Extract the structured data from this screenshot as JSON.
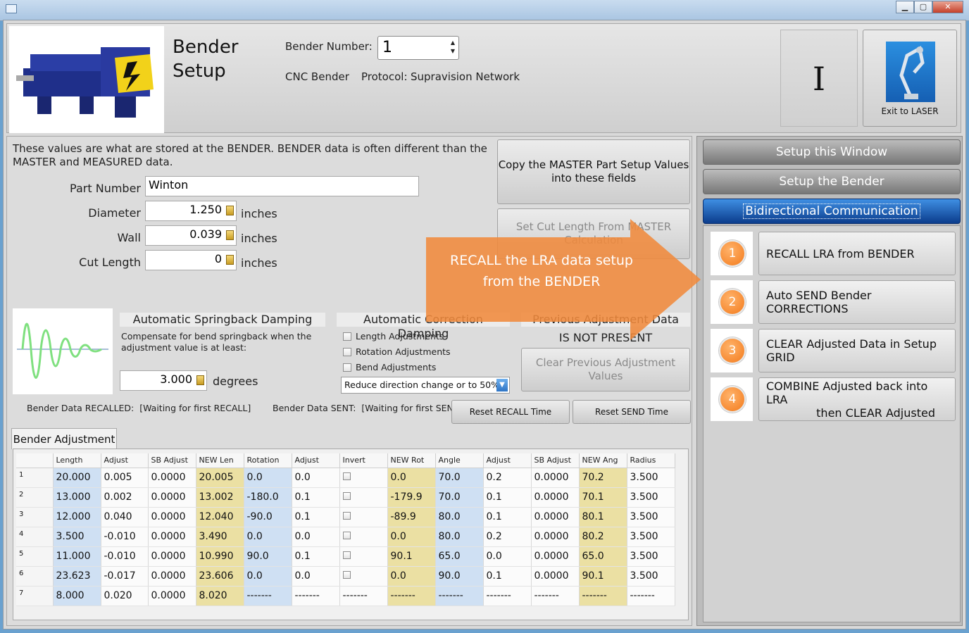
{
  "window": {
    "min": "▁",
    "max": "▢",
    "close": "✕"
  },
  "header": {
    "title_line1": "Bender",
    "title_line2": "Setup",
    "bender_number_label": "Bender Number:",
    "bender_number_value": "1",
    "bender_type": "CNC Bender",
    "protocol_label": "Protocol:",
    "protocol_value": "Supravision Network",
    "indicator": "I",
    "exit_label": "Exit to LASER"
  },
  "description": "These values are what are stored at the BENDER.  BENDER data is often different than the MASTER and MEASURED data.",
  "fields": {
    "part_number_label": "Part Number",
    "part_number_value": "Winton",
    "diameter_label": "Diameter",
    "diameter_value": "1.250",
    "wall_label": "Wall",
    "wall_value": "0.039",
    "cut_length_label": "Cut Length",
    "cut_length_value": "0",
    "unit": "inches"
  },
  "buttons": {
    "copy_master": "Copy the MASTER Part Setup Values into these fields",
    "set_cut_length": "Set Cut Length From MASTER Calculation",
    "clear_previous": "Clear Previous Adjustment Values",
    "reset_recall": "Reset RECALL Time",
    "reset_send": "Reset SEND Time"
  },
  "springback": {
    "header": "Automatic Springback Damping",
    "desc": "Compensate for bend springback when the adjustment value is at least:",
    "value": "3.000",
    "unit": "degrees"
  },
  "correction": {
    "header": "Automatic Correction Damping",
    "options": [
      "Length Adjustments",
      "Rotation Adjustments",
      "Bend Adjustments"
    ],
    "dropdown": "Reduce direction change or to 50%"
  },
  "previous": {
    "header": "Previous Adjustment Data",
    "status": "IS NOT PRESENT"
  },
  "status": {
    "recalled_label": "Bender Data RECALLED:",
    "recalled_value": "[Waiting for first RECALL]",
    "sent_label": "Bender Data SENT:",
    "sent_value": "[Waiting for first SEND]"
  },
  "tab_label": "Bender Adjustment",
  "grid": {
    "columns": [
      "Length",
      "Adjust",
      "SB Adjust",
      "NEW Len",
      "Rotation",
      "Adjust",
      "Invert",
      "NEW Rot",
      "Angle",
      "Adjust",
      "SB Adjust",
      "NEW Ang",
      "Radius"
    ],
    "rows": [
      [
        "1",
        "20.000",
        "0.005",
        "0.0000",
        "20.005",
        "0.0",
        "0.0",
        "chk",
        "0.0",
        "70.0",
        "0.2",
        "0.0000",
        "70.2",
        "3.500"
      ],
      [
        "2",
        "13.000",
        "0.002",
        "0.0000",
        "13.002",
        "-180.0",
        "0.1",
        "chk",
        "-179.9",
        "70.0",
        "0.1",
        "0.0000",
        "70.1",
        "3.500"
      ],
      [
        "3",
        "12.000",
        "0.040",
        "0.0000",
        "12.040",
        "-90.0",
        "0.1",
        "chk",
        "-89.9",
        "80.0",
        "0.1",
        "0.0000",
        "80.1",
        "3.500"
      ],
      [
        "4",
        "3.500",
        "-0.010",
        "0.0000",
        "3.490",
        "0.0",
        "0.0",
        "chk",
        "0.0",
        "80.0",
        "0.2",
        "0.0000",
        "80.2",
        "3.500"
      ],
      [
        "5",
        "11.000",
        "-0.010",
        "0.0000",
        "10.990",
        "90.0",
        "0.1",
        "chk",
        "90.1",
        "65.0",
        "0.0",
        "0.0000",
        "65.0",
        "3.500"
      ],
      [
        "6",
        "23.623",
        "-0.017",
        "0.0000",
        "23.606",
        "0.0",
        "0.0",
        "chk",
        "0.0",
        "90.0",
        "0.1",
        "0.0000",
        "90.1",
        "3.500"
      ],
      [
        "7",
        "8.000",
        "0.020",
        "0.0000",
        "8.020",
        "-------",
        "-------",
        "-------",
        "-------",
        "-------",
        "-------",
        "-------",
        "-------",
        "-------"
      ]
    ]
  },
  "nav": {
    "setup_window": "Setup this Window",
    "setup_bender": "Setup the Bender",
    "bidirectional": "Bidirectional Communication"
  },
  "steps": [
    {
      "num": "1",
      "line1": "RECALL LRA from BENDER",
      "line2": ""
    },
    {
      "num": "2",
      "line1": "Auto SEND Bender CORRECTIONS",
      "line2": ""
    },
    {
      "num": "3",
      "line1": "CLEAR Adjusted Data in Setup GRID",
      "line2": ""
    },
    {
      "num": "4",
      "line1": "COMBINE Adjusted back into LRA",
      "line2": "then CLEAR Adjusted"
    }
  ],
  "callout": {
    "line1": "RECALL the LRA data setup",
    "line2": "from the BENDER"
  },
  "colors": {
    "accent_orange": "#f08a3c",
    "nav_active": "#1e5fb8",
    "grid_blue": "#cfe0f3",
    "grid_yellow": "#ebe0a3"
  }
}
